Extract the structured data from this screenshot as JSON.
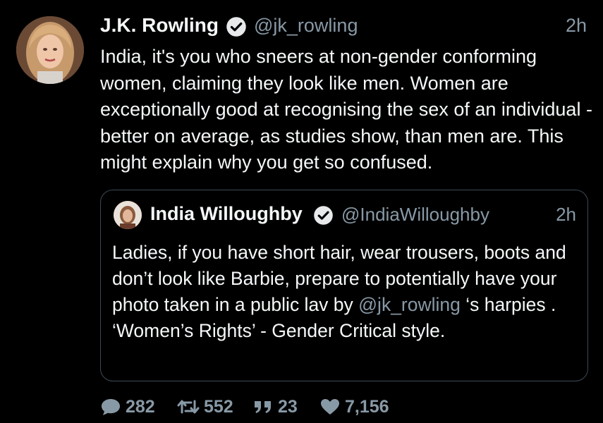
{
  "tweet": {
    "author_name": "J.K. Rowling",
    "author_handle": "@jk_rowling",
    "time": "2h",
    "text": "India, it's you who sneers at non-gender conforming women, claiming they look like men. Women are exceptionally good at recognising the sex of an individual - better on average, as studies show, than men are. This might explain why you get so confused."
  },
  "quoted_tweet": {
    "author_name": "India Willoughby",
    "author_handle": "@IndiaWilloughby",
    "time": "2h",
    "text_before_mention": "Ladies, if you have short hair, wear trousers, boots and don’t look like Barbie, prepare to potentially have your photo taken in a public lav by ",
    "mention": "@jk_rowling",
    "text_after_mention": " ‘s harpies . ‘Women’s Rights’ - Gender Critical style."
  },
  "actions": {
    "replies": "282",
    "retweets": "552",
    "quotes": "23",
    "likes": "7,156"
  },
  "colors": {
    "background": "#000000",
    "text": "#f5f8fa",
    "muted": "#8899a6",
    "verified": "#e7e9ea"
  },
  "icons": [
    "verified-badge-icon",
    "reply-icon",
    "retweet-icon",
    "quote-icon",
    "heart-icon"
  ]
}
